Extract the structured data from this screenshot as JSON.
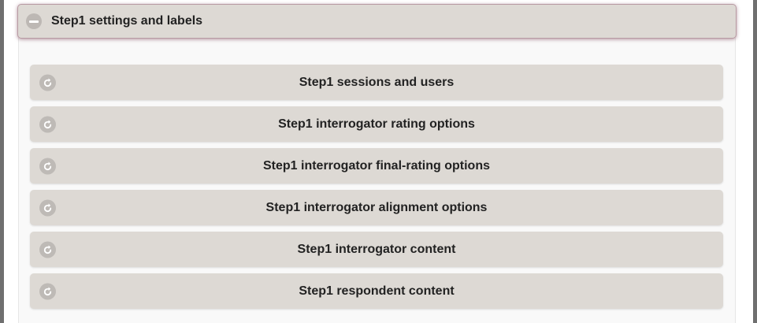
{
  "section": {
    "title": "Step1 settings and labels",
    "toggle_icon": "minus-circle-icon"
  },
  "items": [
    {
      "label": "Step1 sessions and users",
      "icon": "refresh-arrow-icon"
    },
    {
      "label": "Step1 interrogator rating options",
      "icon": "refresh-arrow-icon"
    },
    {
      "label": "Step1 interrogator final-rating options",
      "icon": "refresh-arrow-icon"
    },
    {
      "label": "Step1 interrogator alignment options",
      "icon": "refresh-arrow-icon"
    },
    {
      "label": "Step1 interrogator content",
      "icon": "refresh-arrow-icon"
    },
    {
      "label": "Step1 respondent content",
      "icon": "refresh-arrow-icon"
    }
  ],
  "colors": {
    "panel_bg": "#ddd9d4",
    "header_border": "#b89aa3",
    "icon_bg": "#bebab6",
    "text": "#222222",
    "outer_frame": "#6f6f6f"
  }
}
